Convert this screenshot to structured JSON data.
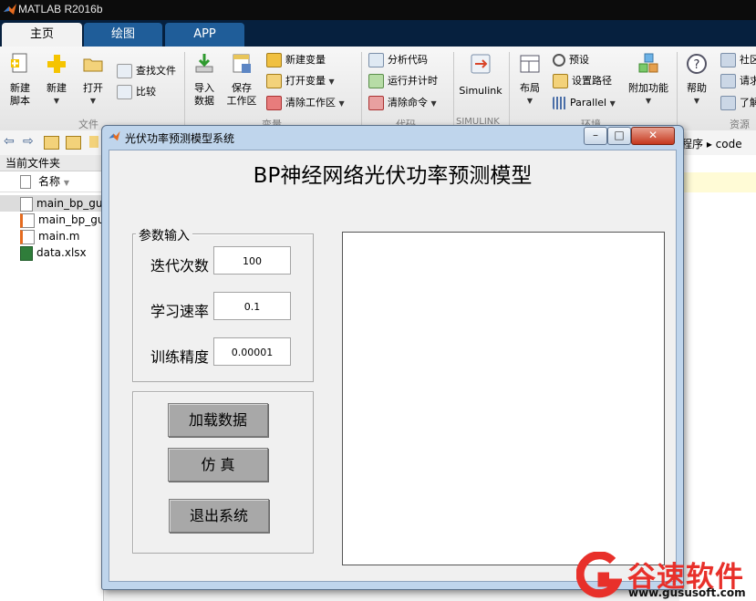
{
  "app": {
    "title": "MATLAB R2016b"
  },
  "tabs": [
    {
      "label": "主页"
    },
    {
      "label": "绘图"
    },
    {
      "label": "APP"
    }
  ],
  "ribbon": {
    "new_script": "新建\n脚本",
    "new": "新建",
    "open": "打开",
    "find_files": "查找文件",
    "compare": "比较",
    "import_data": "导入\n数据",
    "save_workspace": "保存\n工作区",
    "new_variable": "新建变量",
    "open_variable": "打开变量",
    "clear_workspace": "清除工作区",
    "analyze_code": "分析代码",
    "run_and_time": "运行并计时",
    "clear_commands": "清除命令",
    "simulink": "Simulink",
    "layout": "布局",
    "preferences": "预设",
    "set_path": "设置路径",
    "parallel": "Parallel",
    "addons": "附加功能",
    "help": "帮助",
    "community": "社区",
    "request_support": "请求",
    "learn": "了解",
    "group_file": "文件",
    "group_variable": "变量",
    "group_code": "代码",
    "group_simulink": "SIMULINK",
    "group_env": "环境",
    "group_resources": "资源"
  },
  "address": {
    "tail": "程序 ▸ code"
  },
  "file_pane": {
    "title": "当前文件夹",
    "column_name": "名称",
    "files": [
      {
        "name": "main_bp_gu",
        "type": "fig"
      },
      {
        "name": "main_bp_gu",
        "type": "m"
      },
      {
        "name": "main.m",
        "type": "m"
      },
      {
        "name": "data.xlsx",
        "type": "xlsx"
      }
    ]
  },
  "dialog": {
    "window_title": "光伏功率预测模型系统",
    "heading": "BP神经网络光伏功率预测模型",
    "params_title": "参数输入",
    "params": [
      {
        "label": "迭代次数",
        "value": "100"
      },
      {
        "label": "学习速率",
        "value": "0.1"
      },
      {
        "label": "训练精度",
        "value": "0.00001"
      }
    ],
    "buttons": {
      "load": "加载数据",
      "simulate": "仿  真",
      "exit": "退出系统"
    }
  },
  "watermark": {
    "brand": "谷速软件",
    "url": "www.gususoft.com"
  },
  "colors": {
    "accent": "#1f5d99",
    "dark_bar": "#06203e",
    "watermark": "#e8302a"
  }
}
